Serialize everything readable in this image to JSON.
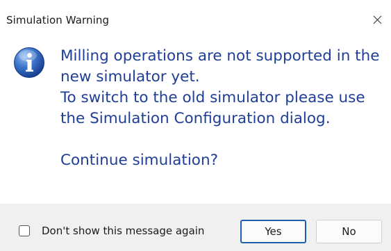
{
  "window": {
    "title": "Simulation Warning",
    "close_icon": "close-icon"
  },
  "message": {
    "icon": "info-icon",
    "lines": [
      "Milling operations are not supported in the",
      "new simulator yet.",
      "To switch to the old simulator please use",
      "the Simulation Configuration dialog."
    ],
    "question": "Continue simulation?"
  },
  "footer": {
    "checkbox_label": "Don't show this message again",
    "checkbox_checked": false,
    "yes_label": "Yes",
    "no_label": "No"
  },
  "colors": {
    "message_text": "#1f3e97",
    "footer_background": "#f0f0f0",
    "default_button_border": "#1f5fb0"
  }
}
